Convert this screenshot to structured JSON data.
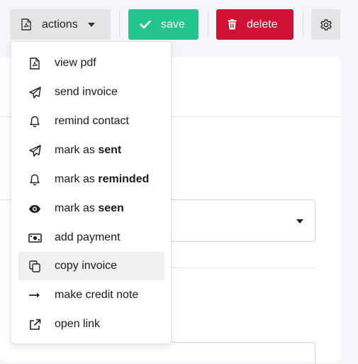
{
  "toolbar": {
    "actions_label": "actions",
    "save_label": "save",
    "delete_label": "delete",
    "colors": {
      "save": "#22c58b",
      "delete": "#cf1233",
      "neutral": "#e4e4e7"
    }
  },
  "menu": {
    "items": [
      {
        "icon": "pdf-file-icon",
        "text": "view pdf",
        "bold": ""
      },
      {
        "icon": "paper-plane-icon",
        "text": "send invoice",
        "bold": ""
      },
      {
        "icon": "bell-icon",
        "text": "remind contact",
        "bold": ""
      },
      {
        "icon": "paper-plane-icon",
        "text": "mark as ",
        "bold": "sent"
      },
      {
        "icon": "bell-icon",
        "text": "mark as ",
        "bold": "reminded"
      },
      {
        "icon": "eye-icon",
        "text": "mark as ",
        "bold": "seen"
      },
      {
        "icon": "money-bill-icon",
        "text": "add payment",
        "bold": ""
      },
      {
        "icon": "copy-icon",
        "text": "copy invoice",
        "bold": "",
        "active": true
      },
      {
        "icon": "arrow-right-icon",
        "text": "make credit note",
        "bold": ""
      },
      {
        "icon": "external-link-icon",
        "text": "open link",
        "bold": ""
      }
    ]
  }
}
